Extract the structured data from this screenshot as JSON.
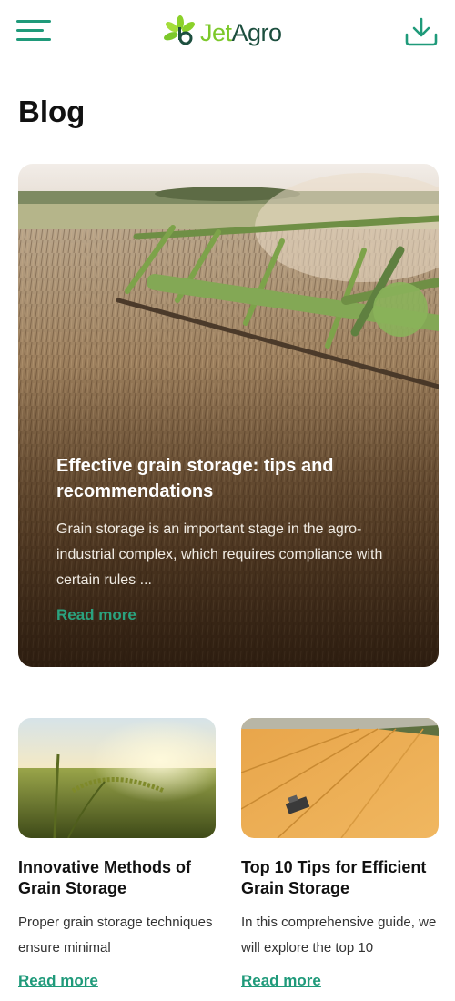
{
  "header": {
    "logo": {
      "jet": "Jet",
      "agro": "Agro"
    },
    "menu_icon": "hamburger-menu-icon",
    "download_icon": "download-icon"
  },
  "page": {
    "title": "Blog"
  },
  "featured": {
    "title": "Effective grain storage: tips and recommendations",
    "excerpt": "Grain storage is an important stage in the agro-industrial complex, which requires compliance with certain rules ...",
    "link": "Read more"
  },
  "cards": [
    {
      "title": "Innovative Methods of Grain Storage",
      "excerpt": "Proper grain storage techniques ensure minimal",
      "link": "Read more"
    },
    {
      "title": "Top 10 Tips for Efficient Grain Storage",
      "excerpt": "In this comprehensive guide, we will explore the top 10",
      "link": "Read more"
    }
  ],
  "colors": {
    "accent": "#1f9a7a",
    "logo_green": "#7cc82a",
    "logo_dark": "#1d4f3f"
  }
}
